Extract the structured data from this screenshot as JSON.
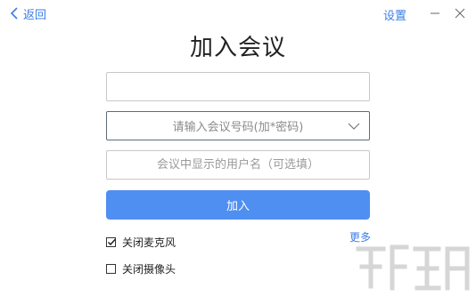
{
  "header": {
    "back_label": "返回",
    "settings_label": "设置"
  },
  "title": "加入会议",
  "form": {
    "top_field_value": "",
    "meeting_id_placeholder": "请输入会议号码(加*密码)",
    "display_name_placeholder": "会议中显示的用户名（可选填）",
    "join_label": "加入",
    "more_label": "更多"
  },
  "options": [
    {
      "label": "关闭麦克风",
      "checked": true
    },
    {
      "label": "关闭摄像头",
      "checked": false
    }
  ],
  "icons": {
    "back": "chevron-left-icon",
    "dropdown": "chevron-down-icon",
    "minimize": "minimize-icon",
    "close": "close-icon",
    "check": "checkmark-icon"
  },
  "colors": {
    "accent": "#3a7ee6",
    "button": "#4f8ff2"
  }
}
